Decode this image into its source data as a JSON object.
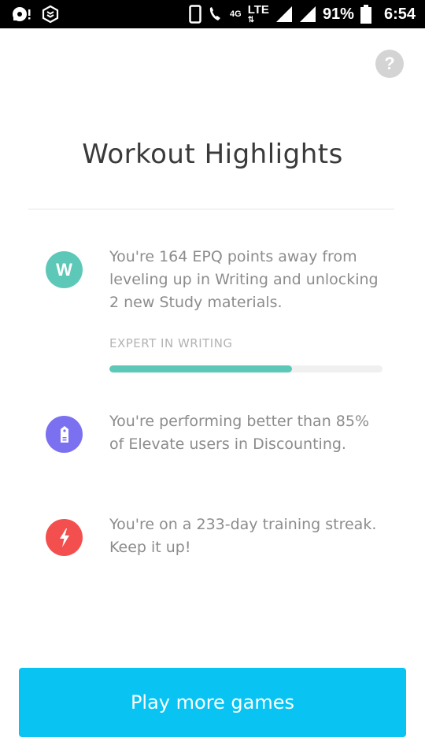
{
  "status_bar": {
    "network_type": "4G",
    "lte": "LTE",
    "battery_percent": "91%",
    "time": "6:54"
  },
  "help": {
    "glyph": "?"
  },
  "page": {
    "title": "Workout Highlights"
  },
  "highlights": [
    {
      "icon": "w-letter-icon",
      "icon_text": "W",
      "color": "#5ec8b8",
      "text": "You're 164 EPQ points away from leveling up in Writing and unlocking 2 new Study materials.",
      "level_label": "EXPERT IN WRITING",
      "progress": 0.67
    },
    {
      "icon": "price-tag-icon",
      "color": "#7b70f0",
      "text": "You're performing better than 85% of Elevate users in Discounting."
    },
    {
      "icon": "lightning-bolt-icon",
      "color": "#f34f4f",
      "text": "You're on a 233-day training streak. Keep it up!"
    }
  ],
  "cta": {
    "label": "Play more games",
    "color": "#09c4f2"
  }
}
